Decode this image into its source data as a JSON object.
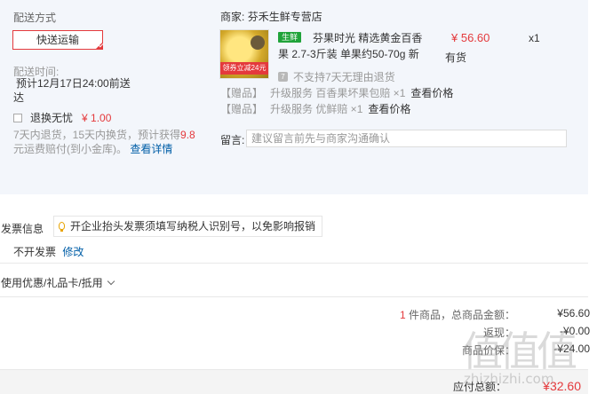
{
  "shipping": {
    "title": "配送方式",
    "method_button": "快送运输",
    "time_label": "配送时间:",
    "time_value_line1": "预计12月17日24:00前送",
    "time_value_line2": "达",
    "return_option": "退换无忧",
    "return_price": "¥ 1.00",
    "return_desc_prefix": "7天内退货，15天内换货，预计获得",
    "return_desc_highlight": "9.8",
    "return_desc_suffix": "元运费赔付(到小金库)。",
    "return_desc_link": "查看详情"
  },
  "shop": {
    "label": "商家:",
    "name": "芬禾生鲜专营店",
    "product": {
      "badge": "生鲜",
      "image_tag": "领券立减24元",
      "title": "芬果时光 精选黄金百香果 2.7-3斤装 单果约50-70g 新",
      "price": "¥ 56.60",
      "quantity": "x1",
      "stock": "有货",
      "no_return": "不支持7天无理由退货"
    },
    "gifts": [
      {
        "tag": "【赠品】",
        "text": "升级服务 百香果坏果包赔 ×1",
        "link": "查看价格"
      },
      {
        "tag": "【赠品】",
        "text": "升级服务 优鲜赔 ×1",
        "link": "查看价格"
      }
    ],
    "message_label": "留言:",
    "message_placeholder": "建议留言前先与商家沟通确认"
  },
  "invoice": {
    "label": "发票信息",
    "tip": "开企业抬头发票须填写纳税人识别号，以免影响报销",
    "value": "不开发票",
    "edit_link": "修改"
  },
  "coupon": {
    "label": "使用优惠/礼品卡/抵用"
  },
  "summary": {
    "items_count": "1",
    "items_label": "件商品，总商品金额：",
    "items_value": "¥56.60",
    "row2_label": "返现：",
    "row2_value": "-¥0.00",
    "row3_label": "商品价保：",
    "row3_value": "-¥24.00",
    "total_label": "应付总额：",
    "total_value": "¥32.60"
  },
  "watermark": {
    "glyphs": "值值值",
    "url": "zhizhizhi.com"
  }
}
